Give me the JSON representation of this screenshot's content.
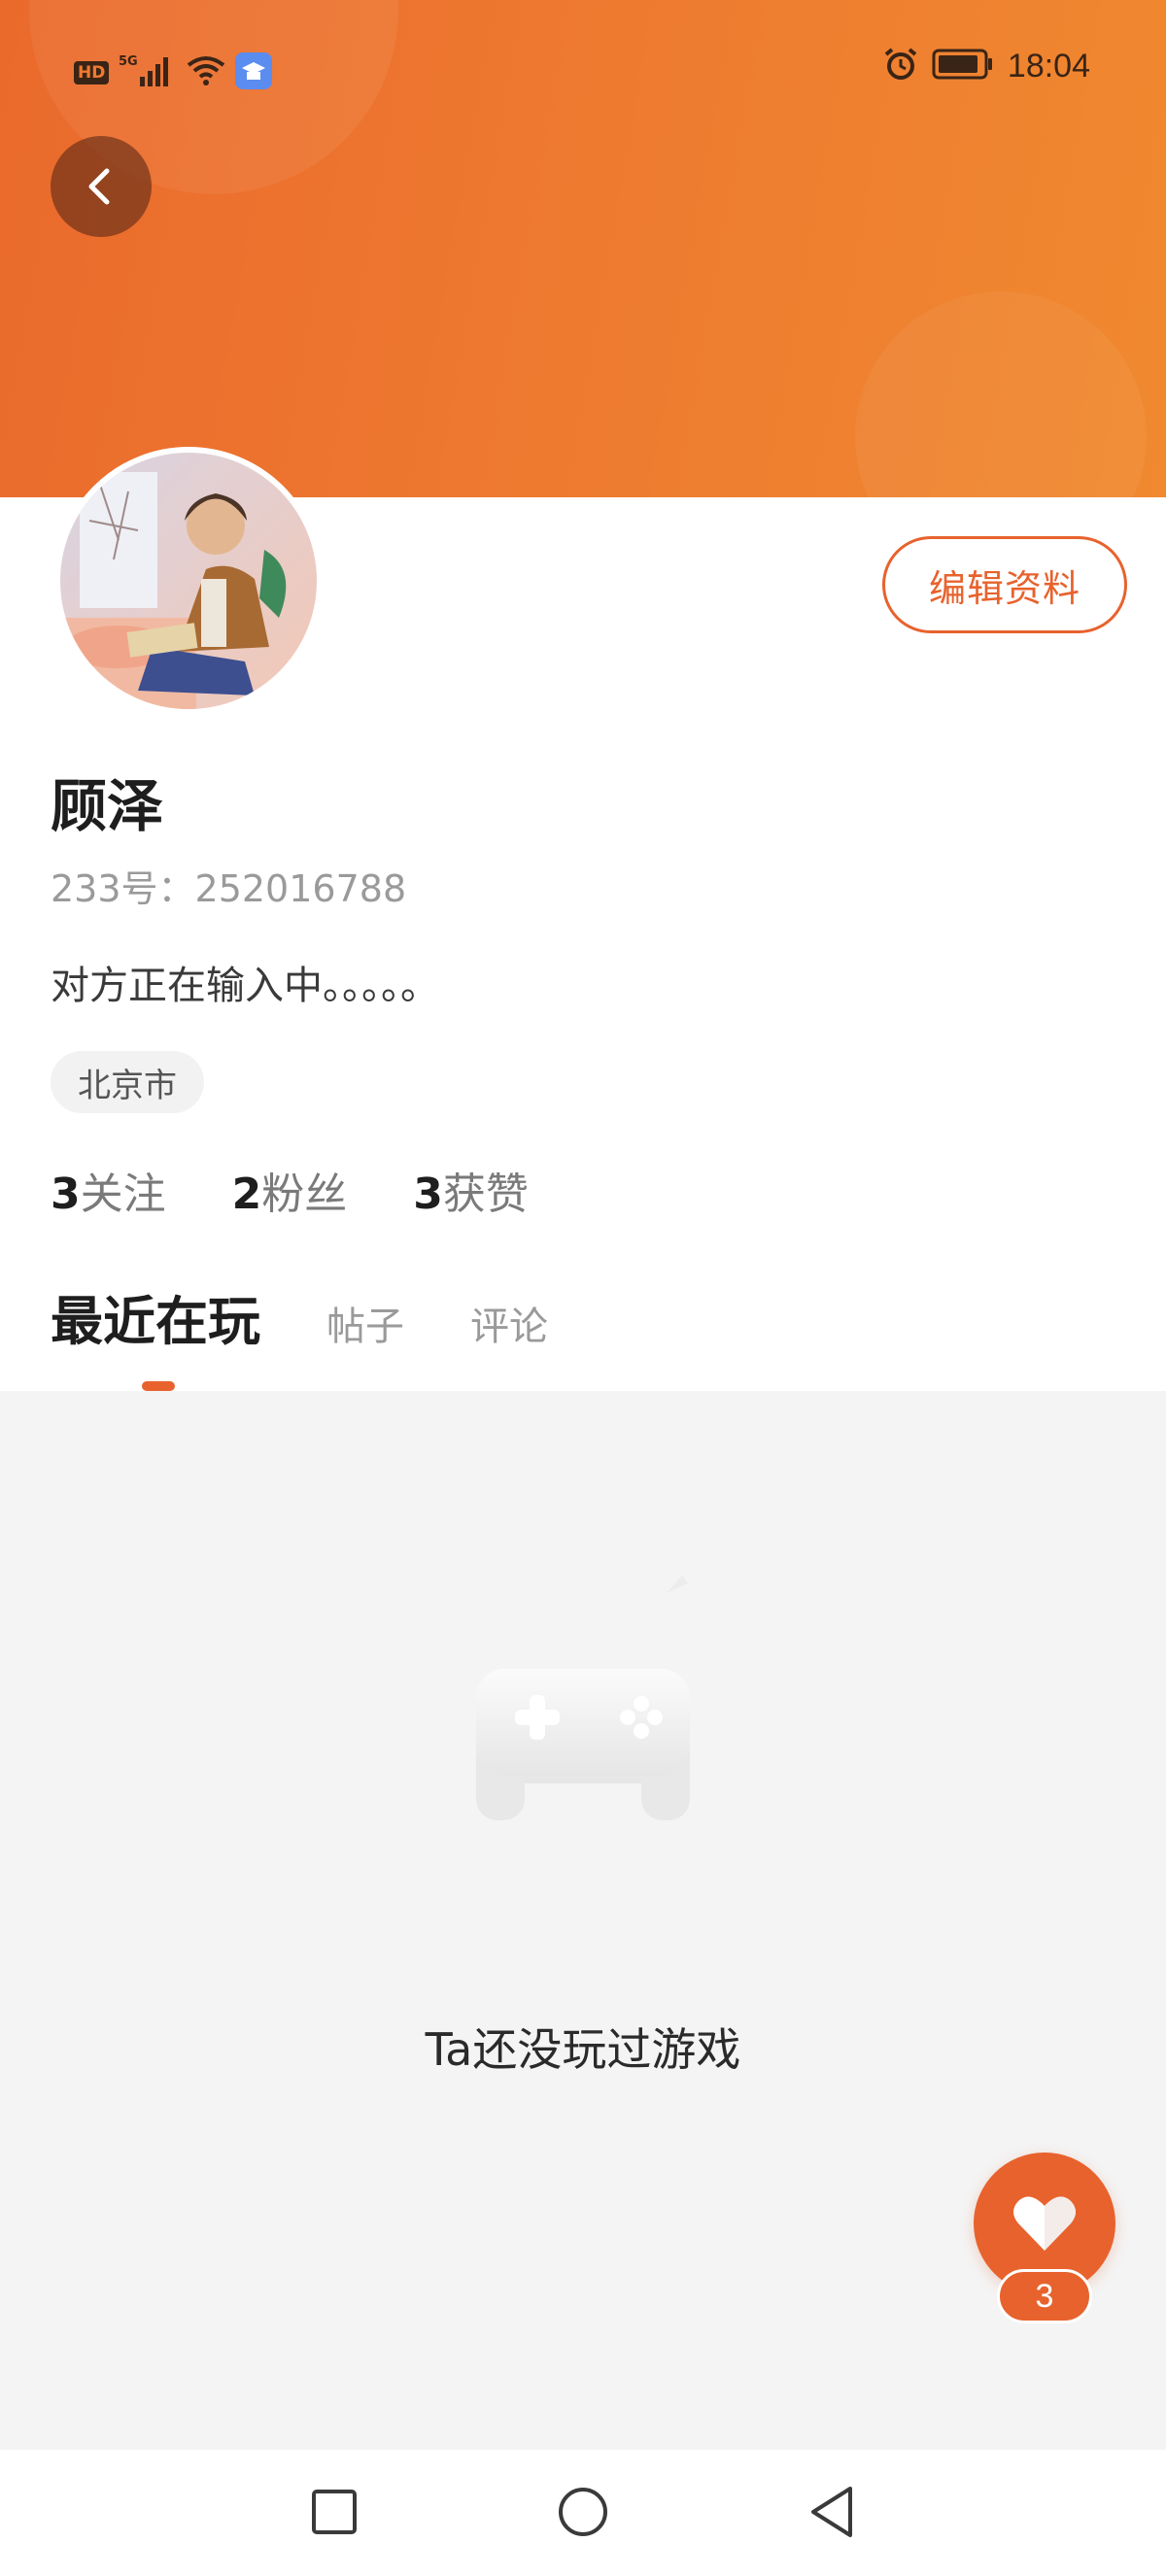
{
  "status_bar": {
    "hd": "HD",
    "network": "5G",
    "time": "18:04"
  },
  "profile": {
    "name": "顾泽",
    "id_line": "233号：252016788",
    "signature": "对方正在输入中。。。。。",
    "location": "北京市",
    "edit_button": "编辑资料",
    "stats": [
      {
        "num": "3",
        "label": "关注"
      },
      {
        "num": "2",
        "label": "粉丝"
      },
      {
        "num": "3",
        "label": "获赞"
      }
    ]
  },
  "tabs": [
    {
      "label": "最近在玩",
      "active": true
    },
    {
      "label": "帖子",
      "active": false
    },
    {
      "label": "评论",
      "active": false
    }
  ],
  "empty_state": {
    "text": "Ta还没玩过游戏",
    "icon": "gamepad-icon"
  },
  "like_button": {
    "count": "3",
    "icon": "heart-icon"
  },
  "colors": {
    "accent": "#e8622d",
    "header_start": "#ea6a2c",
    "header_end": "#f0892f"
  }
}
